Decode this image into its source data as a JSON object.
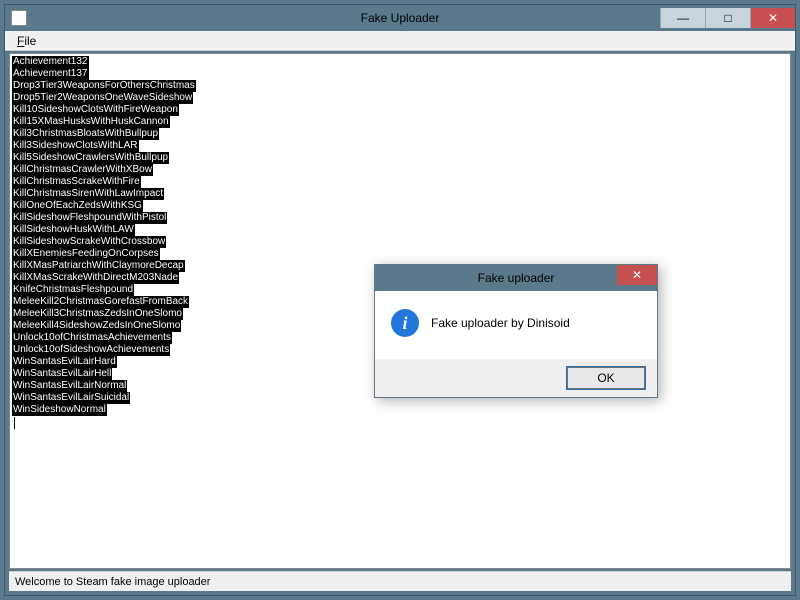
{
  "window": {
    "title": "Fake Uploader",
    "minimize": "—",
    "maximize": "□",
    "close": "✕"
  },
  "menubar": {
    "file_label": "File",
    "file_accel": "F"
  },
  "achievements": [
    "Achievement132",
    "Achievement137",
    "Drop3Tier3WeaponsForOthersChristmas",
    "Drop5Tier2WeaponsOneWaveSideshow",
    "Kill10SideshowClotsWithFireWeapon",
    "Kill15XMasHusksWithHuskCannon",
    "Kill3ChristmasBloatsWithBullpup",
    "Kill3SideshowClotsWithLAR",
    "Kill5SideshowCrawlersWithBullpup",
    "KillChristmasCrawlerWithXBow",
    "KillChristmasScrakeWithFire",
    "KillChristmasSirenWithLawImpact",
    "KillOneOfEachZedsWithKSG",
    "KillSideshowFleshpoundWithPistol",
    "KillSideshowHuskWithLAW",
    "KillSideshowScrakeWithCrossbow",
    "KillXEnemiesFeedingOnCorpses",
    "KillXMasPatriarchWithClaymoreDecap",
    "KillXMasScrakeWithDirectM203Nade",
    "KnifeChristmasFleshpound",
    "MeleeKill2ChristmasGorefastFromBack",
    "MeleeKill3ChristmasZedsInOneSlomo",
    "MeleeKill4SideshowZedsInOneSlomo",
    "Unlock10ofChristmasAchievements",
    "Unlock10ofSideshowAchievements",
    "WinSantasEvilLairHard",
    "WinSantasEvilLairHell",
    "WinSantasEvilLairNormal",
    "WinSantasEvilLairSuicidal",
    "WinSideshowNormal"
  ],
  "statusbar": {
    "text": "Welcome to Steam fake image uploader"
  },
  "dialog": {
    "title": "Fake uploader",
    "close": "✕",
    "message": "Fake uploader by Dinisoid",
    "ok_label": "OK",
    "icon_glyph": "i"
  }
}
